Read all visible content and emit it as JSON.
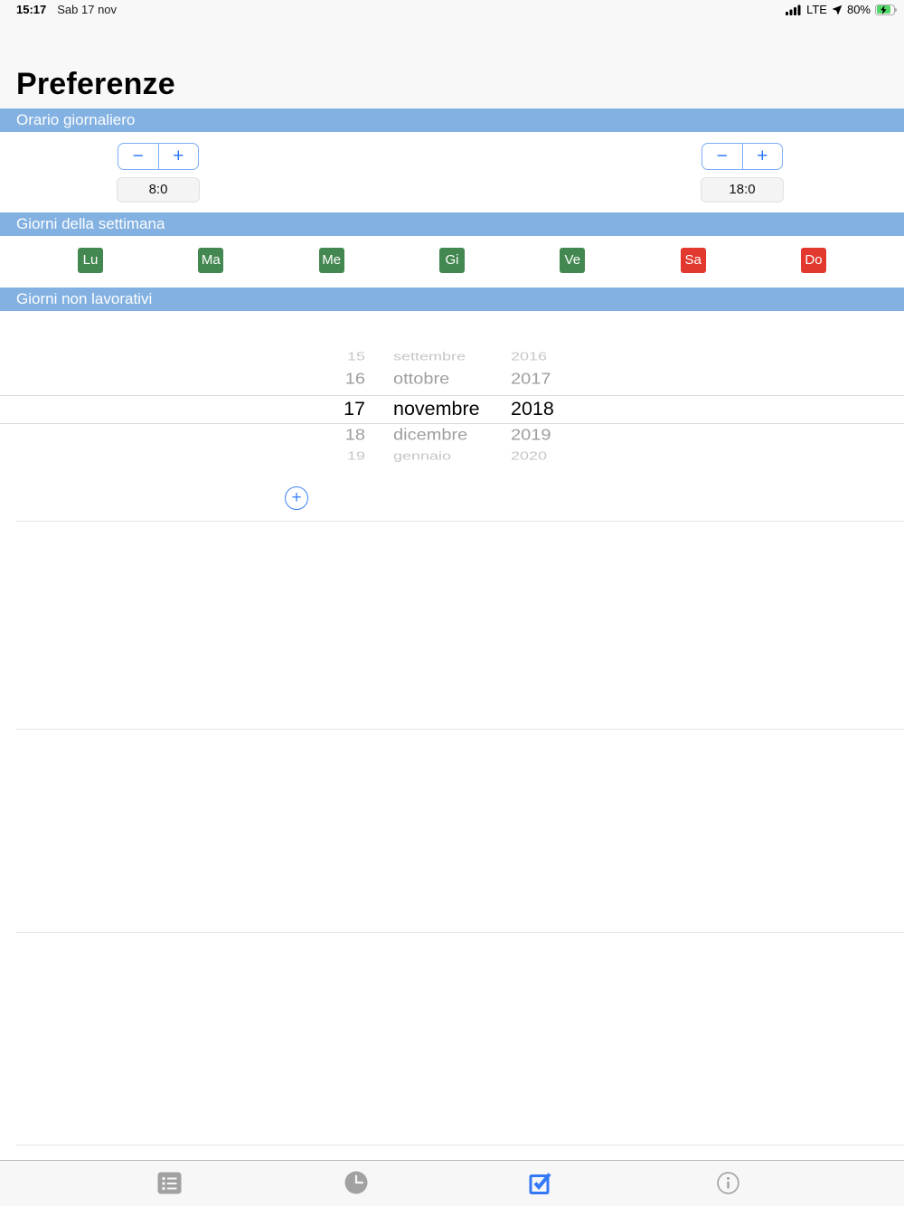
{
  "status_bar": {
    "time": "15:17",
    "date": "Sab 17 nov",
    "network": "LTE",
    "battery_percent": "80%",
    "battery_charging": true,
    "signal_bars": 4
  },
  "header": {
    "title": "Preferenze"
  },
  "sections": {
    "daily_schedule": {
      "title": "Orario giornaliero",
      "minus_label": "−",
      "plus_label": "+",
      "start_value": "8:0",
      "end_value": "18:0"
    },
    "week_days": {
      "title": "Giorni della settimana",
      "days": [
        {
          "label": "Lu",
          "state": "working"
        },
        {
          "label": "Ma",
          "state": "working"
        },
        {
          "label": "Me",
          "state": "working"
        },
        {
          "label": "Gi",
          "state": "working"
        },
        {
          "label": "Ve",
          "state": "working"
        },
        {
          "label": "Sa",
          "state": "nonworking"
        },
        {
          "label": "Do",
          "state": "nonworking"
        }
      ]
    },
    "non_working_days": {
      "title": "Giorni non lavorativi",
      "picker_rows": [
        {
          "day": "15",
          "month": "settembre",
          "year": "2016",
          "selected": false
        },
        {
          "day": "16",
          "month": "ottobre",
          "year": "2017",
          "selected": false
        },
        {
          "day": "17",
          "month": "novembre",
          "year": "2018",
          "selected": true
        },
        {
          "day": "18",
          "month": "dicembre",
          "year": "2019",
          "selected": false
        },
        {
          "day": "19",
          "month": "gennaio",
          "year": "2020",
          "selected": false
        }
      ],
      "add_button_label": "+"
    }
  },
  "tab_bar": {
    "items": [
      {
        "icon": "list-icon",
        "state": "inactive"
      },
      {
        "icon": "clock-icon",
        "state": "inactive"
      },
      {
        "icon": "checkbox-icon",
        "state": "active"
      },
      {
        "icon": "info-icon",
        "state": "inactive"
      }
    ]
  },
  "colors": {
    "section_header_blue": "#82B1E2",
    "accent_blue": "#3478F6",
    "working_green": "#448851",
    "nonworking_red": "#E2382D",
    "battery_green": "#53D769"
  }
}
